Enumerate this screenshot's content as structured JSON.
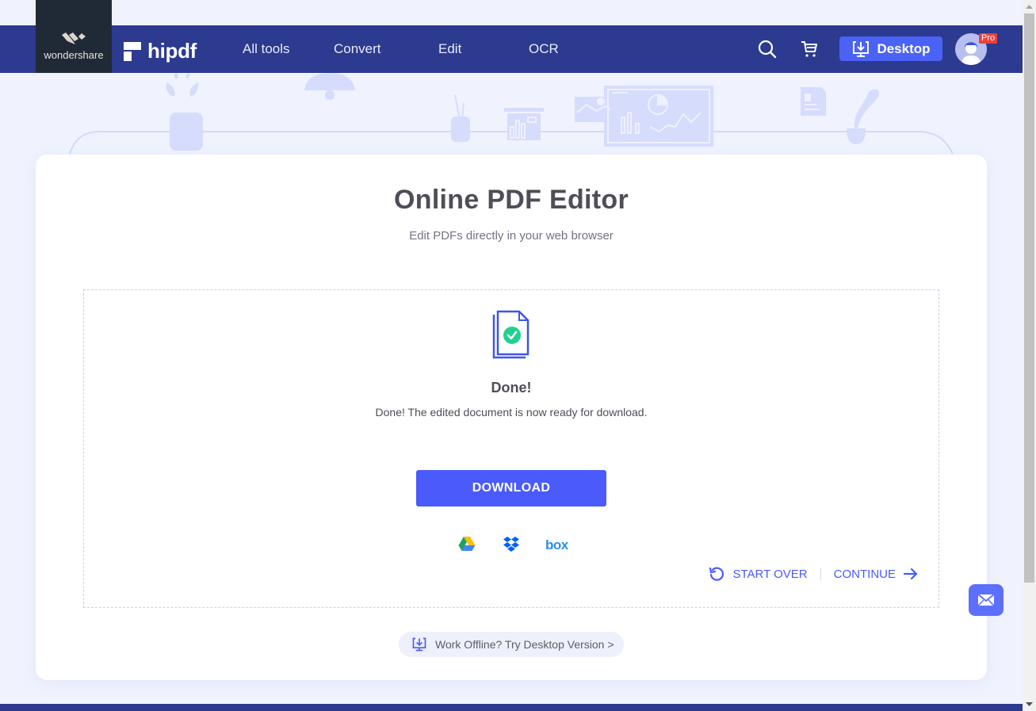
{
  "brand": {
    "parent": "wondershare",
    "product": "hipdf"
  },
  "nav": {
    "items": [
      {
        "label": "All tools"
      },
      {
        "label": "Convert"
      },
      {
        "label": "Edit"
      },
      {
        "label": "OCR"
      }
    ],
    "desktop_label": "Desktop",
    "pro_badge": "Pro"
  },
  "main": {
    "title": "Online PDF Editor",
    "subtitle": "Edit PDFs directly in your web browser",
    "status_title": "Done!",
    "status_message": "Done! The edited document is now ready for download.",
    "download_label": "DOWNLOAD",
    "cloud_services": [
      {
        "name": "Google Drive",
        "icon": "google-drive-icon"
      },
      {
        "name": "Dropbox",
        "icon": "dropbox-icon"
      },
      {
        "name": "box",
        "icon": "box-icon"
      }
    ],
    "start_over_label": "START OVER",
    "continue_label": "CONTINUE",
    "offline_label": "Work Offline? Try Desktop Version >"
  },
  "colors": {
    "navbar": "#2c3a8f",
    "accent": "#4a5afb",
    "success": "#1fd18f",
    "pro": "#e9413e"
  }
}
